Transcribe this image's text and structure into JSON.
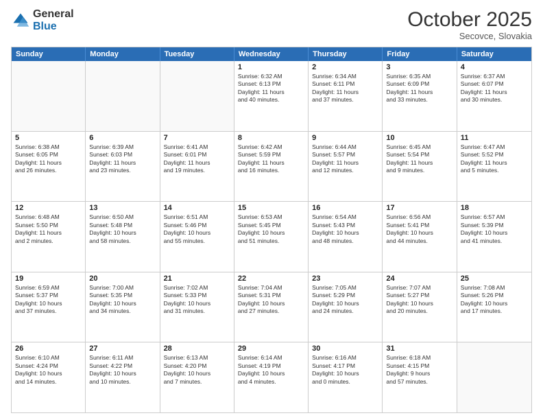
{
  "header": {
    "logo_general": "General",
    "logo_blue": "Blue",
    "month": "October 2025",
    "location": "Secovce, Slovakia"
  },
  "days_of_week": [
    "Sunday",
    "Monday",
    "Tuesday",
    "Wednesday",
    "Thursday",
    "Friday",
    "Saturday"
  ],
  "rows": [
    [
      {
        "day": "",
        "text": ""
      },
      {
        "day": "",
        "text": ""
      },
      {
        "day": "",
        "text": ""
      },
      {
        "day": "1",
        "text": "Sunrise: 6:32 AM\nSunset: 6:13 PM\nDaylight: 11 hours\nand 40 minutes."
      },
      {
        "day": "2",
        "text": "Sunrise: 6:34 AM\nSunset: 6:11 PM\nDaylight: 11 hours\nand 37 minutes."
      },
      {
        "day": "3",
        "text": "Sunrise: 6:35 AM\nSunset: 6:09 PM\nDaylight: 11 hours\nand 33 minutes."
      },
      {
        "day": "4",
        "text": "Sunrise: 6:37 AM\nSunset: 6:07 PM\nDaylight: 11 hours\nand 30 minutes."
      }
    ],
    [
      {
        "day": "5",
        "text": "Sunrise: 6:38 AM\nSunset: 6:05 PM\nDaylight: 11 hours\nand 26 minutes."
      },
      {
        "day": "6",
        "text": "Sunrise: 6:39 AM\nSunset: 6:03 PM\nDaylight: 11 hours\nand 23 minutes."
      },
      {
        "day": "7",
        "text": "Sunrise: 6:41 AM\nSunset: 6:01 PM\nDaylight: 11 hours\nand 19 minutes."
      },
      {
        "day": "8",
        "text": "Sunrise: 6:42 AM\nSunset: 5:59 PM\nDaylight: 11 hours\nand 16 minutes."
      },
      {
        "day": "9",
        "text": "Sunrise: 6:44 AM\nSunset: 5:57 PM\nDaylight: 11 hours\nand 12 minutes."
      },
      {
        "day": "10",
        "text": "Sunrise: 6:45 AM\nSunset: 5:54 PM\nDaylight: 11 hours\nand 9 minutes."
      },
      {
        "day": "11",
        "text": "Sunrise: 6:47 AM\nSunset: 5:52 PM\nDaylight: 11 hours\nand 5 minutes."
      }
    ],
    [
      {
        "day": "12",
        "text": "Sunrise: 6:48 AM\nSunset: 5:50 PM\nDaylight: 11 hours\nand 2 minutes."
      },
      {
        "day": "13",
        "text": "Sunrise: 6:50 AM\nSunset: 5:48 PM\nDaylight: 10 hours\nand 58 minutes."
      },
      {
        "day": "14",
        "text": "Sunrise: 6:51 AM\nSunset: 5:46 PM\nDaylight: 10 hours\nand 55 minutes."
      },
      {
        "day": "15",
        "text": "Sunrise: 6:53 AM\nSunset: 5:45 PM\nDaylight: 10 hours\nand 51 minutes."
      },
      {
        "day": "16",
        "text": "Sunrise: 6:54 AM\nSunset: 5:43 PM\nDaylight: 10 hours\nand 48 minutes."
      },
      {
        "day": "17",
        "text": "Sunrise: 6:56 AM\nSunset: 5:41 PM\nDaylight: 10 hours\nand 44 minutes."
      },
      {
        "day": "18",
        "text": "Sunrise: 6:57 AM\nSunset: 5:39 PM\nDaylight: 10 hours\nand 41 minutes."
      }
    ],
    [
      {
        "day": "19",
        "text": "Sunrise: 6:59 AM\nSunset: 5:37 PM\nDaylight: 10 hours\nand 37 minutes."
      },
      {
        "day": "20",
        "text": "Sunrise: 7:00 AM\nSunset: 5:35 PM\nDaylight: 10 hours\nand 34 minutes."
      },
      {
        "day": "21",
        "text": "Sunrise: 7:02 AM\nSunset: 5:33 PM\nDaylight: 10 hours\nand 31 minutes."
      },
      {
        "day": "22",
        "text": "Sunrise: 7:04 AM\nSunset: 5:31 PM\nDaylight: 10 hours\nand 27 minutes."
      },
      {
        "day": "23",
        "text": "Sunrise: 7:05 AM\nSunset: 5:29 PM\nDaylight: 10 hours\nand 24 minutes."
      },
      {
        "day": "24",
        "text": "Sunrise: 7:07 AM\nSunset: 5:27 PM\nDaylight: 10 hours\nand 20 minutes."
      },
      {
        "day": "25",
        "text": "Sunrise: 7:08 AM\nSunset: 5:26 PM\nDaylight: 10 hours\nand 17 minutes."
      }
    ],
    [
      {
        "day": "26",
        "text": "Sunrise: 6:10 AM\nSunset: 4:24 PM\nDaylight: 10 hours\nand 14 minutes."
      },
      {
        "day": "27",
        "text": "Sunrise: 6:11 AM\nSunset: 4:22 PM\nDaylight: 10 hours\nand 10 minutes."
      },
      {
        "day": "28",
        "text": "Sunrise: 6:13 AM\nSunset: 4:20 PM\nDaylight: 10 hours\nand 7 minutes."
      },
      {
        "day": "29",
        "text": "Sunrise: 6:14 AM\nSunset: 4:19 PM\nDaylight: 10 hours\nand 4 minutes."
      },
      {
        "day": "30",
        "text": "Sunrise: 6:16 AM\nSunset: 4:17 PM\nDaylight: 10 hours\nand 0 minutes."
      },
      {
        "day": "31",
        "text": "Sunrise: 6:18 AM\nSunset: 4:15 PM\nDaylight: 9 hours\nand 57 minutes."
      },
      {
        "day": "",
        "text": ""
      }
    ]
  ]
}
